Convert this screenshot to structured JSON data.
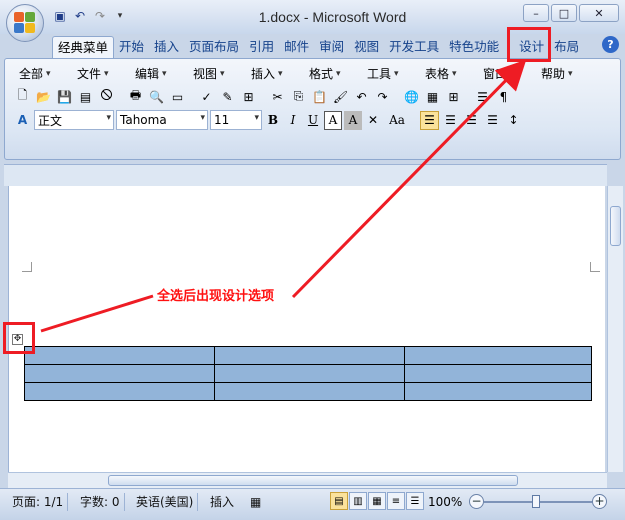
{
  "window": {
    "title": "1.docx - Microsoft Word",
    "minimize_label": "–",
    "maximize_label": "□",
    "close_label": "✕"
  },
  "tabs": [
    {
      "label": "经典菜单",
      "active": true
    },
    {
      "label": "开始"
    },
    {
      "label": "插入"
    },
    {
      "label": "页面布局"
    },
    {
      "label": "引用"
    },
    {
      "label": "邮件"
    },
    {
      "label": "审阅"
    },
    {
      "label": "视图"
    },
    {
      "label": "开发工具"
    },
    {
      "label": "特色功能"
    },
    {
      "label": "设计"
    },
    {
      "label": "布局"
    }
  ],
  "menus": [
    "全部",
    "文件",
    "编辑",
    "视图",
    "插入",
    "格式",
    "工具",
    "表格",
    "窗口",
    "帮助"
  ],
  "format": {
    "style": "正文",
    "font": "Tahoma",
    "size": "11",
    "bold": "B",
    "italic": "I",
    "underline": "U",
    "font_color_letter": "A",
    "shade_letter": "A",
    "case_label": "Aa"
  },
  "annotation": "全选后出现设计选项",
  "status": {
    "page": "页面: 1/1",
    "words": "字数: 0",
    "language": "英语(美国)",
    "mode": "插入",
    "zoom": "100%",
    "zoom_minus": "−",
    "zoom_plus": "+"
  },
  "table": {
    "rows": 3,
    "cols": 3
  },
  "colors": {
    "accent_red": "#ee1c24",
    "table_selection": "#92b4d9"
  },
  "icons": [
    "office-button-icon",
    "save-icon",
    "undo-icon",
    "redo-icon",
    "help-icon",
    "table-move-icon"
  ]
}
